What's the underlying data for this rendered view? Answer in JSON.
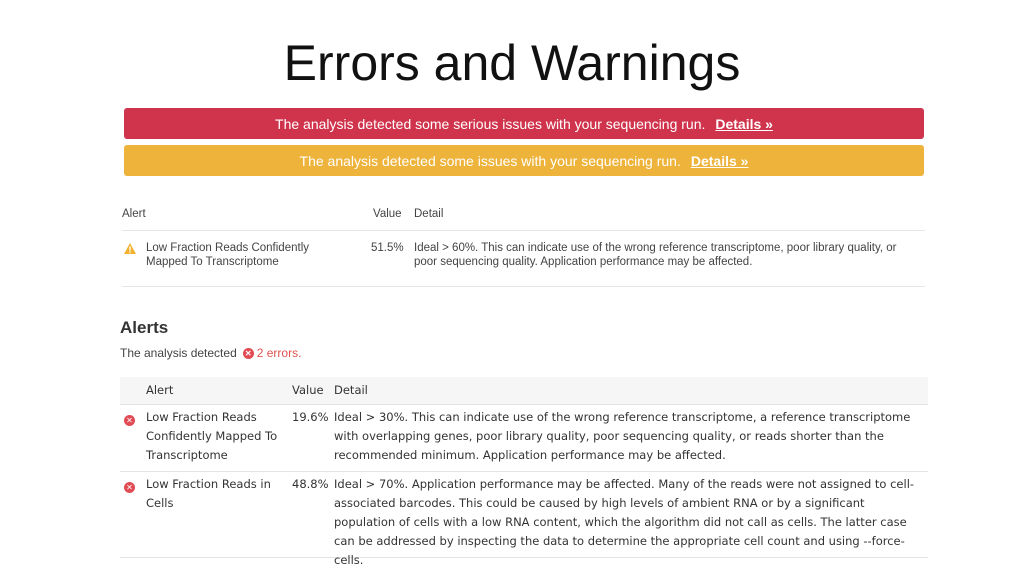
{
  "title": "Errors and Warnings",
  "banners": {
    "error": {
      "text": "The analysis detected some serious issues with your sequencing run.",
      "link": "Details »",
      "color": "#d0344d"
    },
    "warning": {
      "text": "The analysis detected some issues with your sequencing run.",
      "link": "Details »",
      "color": "#eeb33a"
    }
  },
  "warning_table": {
    "headers": {
      "alert": "Alert",
      "value": "Value",
      "detail": "Detail"
    },
    "rows": [
      {
        "icon": "warning-triangle-icon",
        "alert": "Low Fraction Reads Confidently Mapped To Transcriptome",
        "value": "51.5%",
        "detail": "Ideal > 60%. This can indicate use of the wrong reference transcriptome, poor library quality, or poor sequencing quality. Application performance may be affected."
      }
    ]
  },
  "alerts": {
    "heading": "Alerts",
    "summary_prefix": "The analysis detected",
    "count_text": "2 errors.",
    "headers": {
      "alert": "Alert",
      "value": "Value",
      "detail": "Detail"
    },
    "rows": [
      {
        "icon": "error-x-icon",
        "alert": "Low Fraction Reads Confidently Mapped To Transcriptome",
        "value": "19.6%",
        "detail": "Ideal > 30%. This can indicate use of the wrong reference transcriptome, a reference transcriptome with overlapping genes, poor library quality, poor sequencing quality, or reads shorter than the recommended minimum. Application performance may be affected."
      },
      {
        "icon": "error-x-icon",
        "alert": "Low Fraction Reads in Cells",
        "value": "48.8%",
        "detail": "Ideal > 70%. Application performance may be affected. Many of the reads were not assigned to cell-associated barcodes. This could be caused by high levels of ambient RNA or by a significant population of cells with a low RNA content, which the algorithm did not call as cells. The latter case can be addressed by inspecting the data to determine the appropriate cell count and using --force-cells."
      }
    ]
  }
}
